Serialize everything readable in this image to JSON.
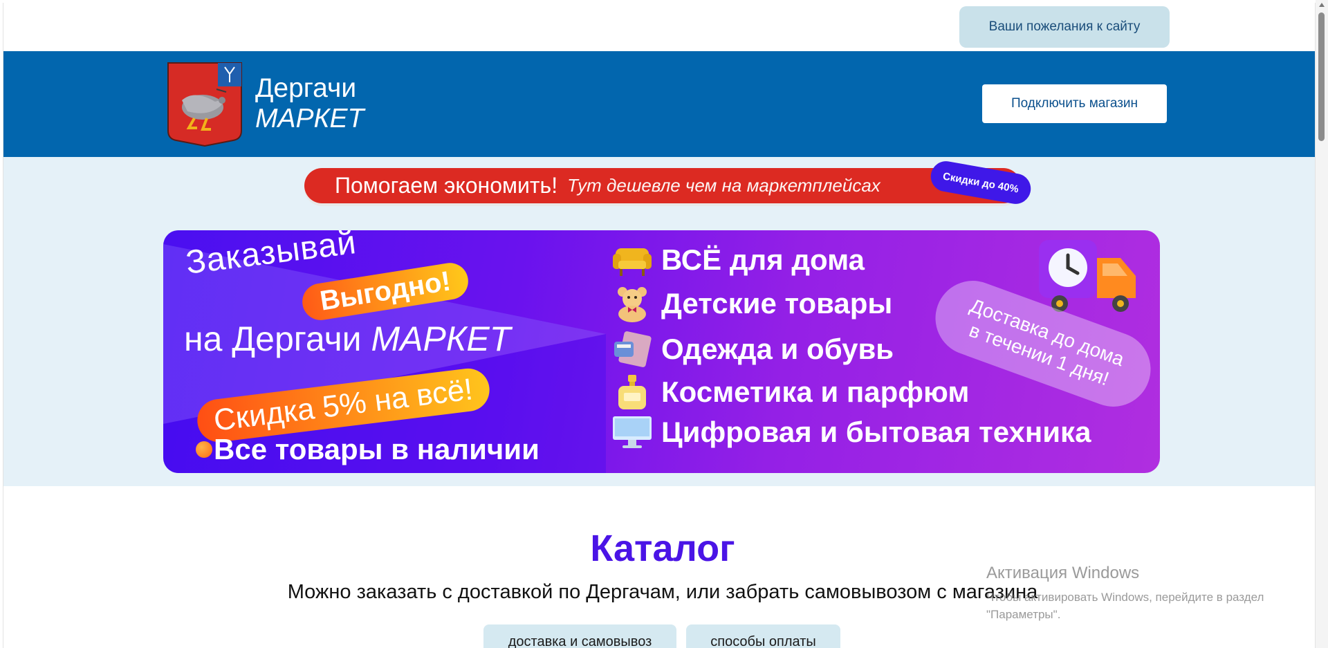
{
  "top_bar": {
    "wish_label": "Ваши пожелания к сайту"
  },
  "header": {
    "logo_line1": "Дергачи",
    "logo_line2": "МАРКЕТ",
    "connect_label": "Подключить магазин",
    "brand_color": "#0266ae"
  },
  "slogan": {
    "main": "Помогаем экономить!",
    "sub": "Тут дешевле чем на маркетплейсах",
    "badge": "Скидки до 40%"
  },
  "banner": {
    "order": "Заказывай",
    "profitable": "Выгодно!",
    "on": "на Дергачи",
    "market": "МАРКЕТ",
    "discount": "Скидка 5% на всё!",
    "in_stock": "Все товары в наличии",
    "categories": [
      {
        "label": "ВСЁ для дома",
        "icon": "sofa-icon"
      },
      {
        "label": "Детские товары",
        "icon": "teddy-bear-icon"
      },
      {
        "label": "Одежда и обувь",
        "icon": "clothes-icon"
      },
      {
        "label": "Косметика и парфюм",
        "icon": "perfume-icon"
      },
      {
        "label": "Цифровая и бытовая техника",
        "icon": "monitor-icon"
      }
    ],
    "delivery_line1": "Доставка до дома",
    "delivery_line2": "в течении 1 дня!"
  },
  "catalog": {
    "title": "Каталог",
    "subtitle": "Можно заказать с доставкой по Дергачам, или забрать самовывозом с магазина",
    "tabs": [
      "доставка и самовывоз",
      "способы оплаты"
    ]
  },
  "watermark": {
    "title": "Активация Windows",
    "text": "Чтобы активировать Windows, перейдите в раздел \"Параметры\"."
  }
}
